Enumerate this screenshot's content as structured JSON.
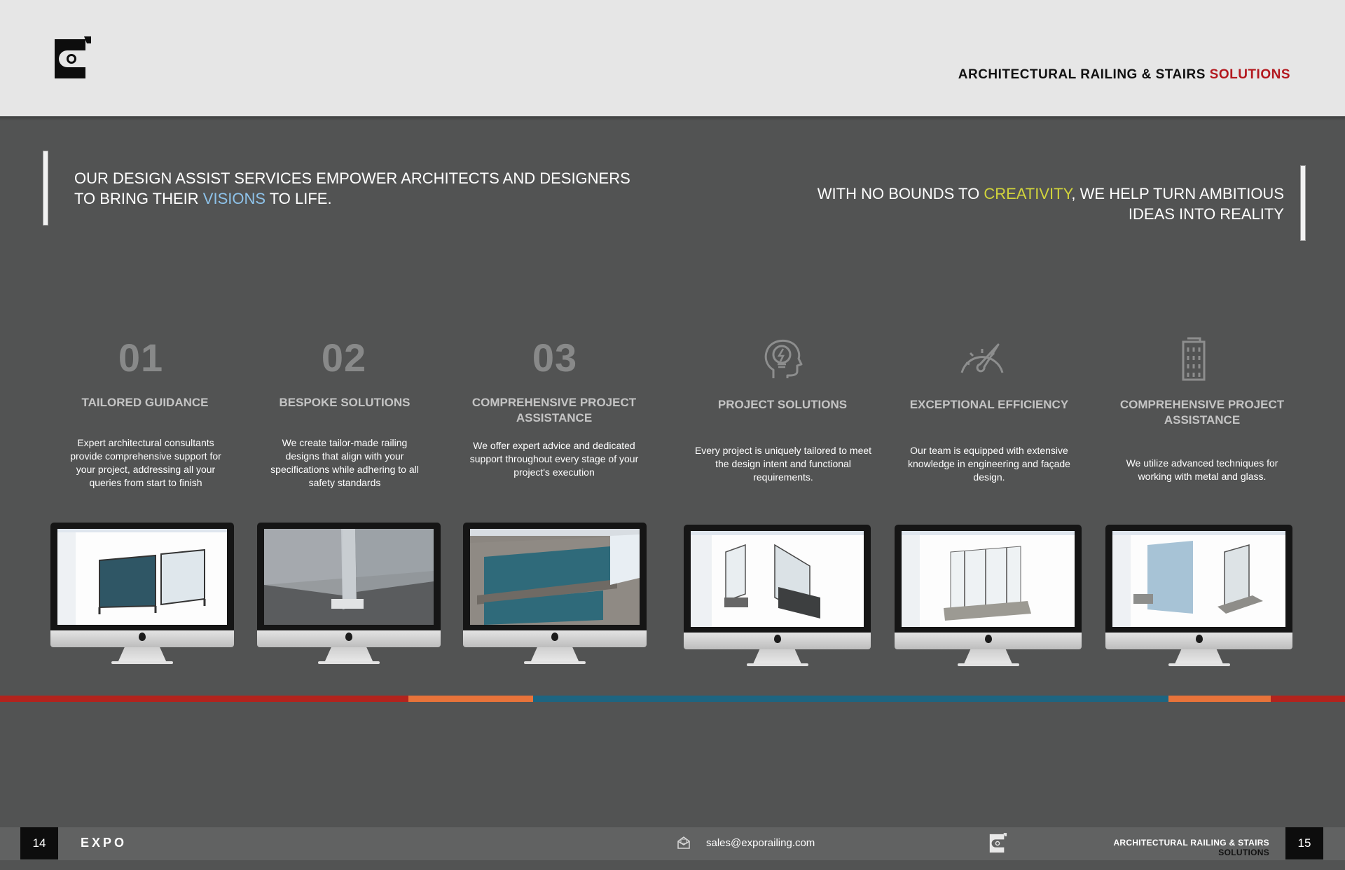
{
  "header": {
    "title_main": "ARCHITECTURAL RAILING & STAIRS ",
    "title_accent": "SOLUTIONS"
  },
  "quote_left": {
    "before": "OUR DESIGN ASSIST SERVICES EMPOWER ARCHITECTS AND DESIGNERS TO BRING THEIR ",
    "highlight": "VISIONS",
    "after": " TO LIFE."
  },
  "quote_right": {
    "before": "WITH NO BOUNDS TO ",
    "highlight": "CREATIVITY",
    "after": ", WE HELP TURN AMBITIOUS IDEAS INTO REALITY"
  },
  "features_left": [
    {
      "num": "01",
      "title": "TAILORED GUIDANCE",
      "desc": "Expert architectural consultants provide comprehensive support for your project, addressing all your queries from start to finish"
    },
    {
      "num": "02",
      "title": "BESPOKE SOLUTIONS",
      "desc": "We create tailor-made railing designs that align with your specifications while adhering to all safety standards"
    },
    {
      "num": "03",
      "title": "COMPREHENSIVE PROJECT ASSISTANCE",
      "desc": "We offer expert advice and dedicated support throughout every stage of your project's execution"
    }
  ],
  "features_right": [
    {
      "icon": "lightbulb-head-icon",
      "title": "PROJECT SOLUTIONS",
      "desc": "Every project is uniquely tailored to meet the design intent and functional requirements."
    },
    {
      "icon": "speedometer-icon",
      "title": "EXCEPTIONAL EFFICIENCY",
      "desc": "Our team is equipped with extensive knowledge in engineering and façade design."
    },
    {
      "icon": "building-icon",
      "title": "COMPREHENSIVE PROJECT ASSISTANCE",
      "desc": "We utilize advanced techniques for working with metal and glass."
    }
  ],
  "footer": {
    "page_left": "14",
    "brand": "EXPO",
    "email": "sales@exporailing.com",
    "tag_line1": "ARCHITECTURAL RAILING & STAIRS",
    "tag_line2": "SOLUTIONS",
    "page_right": "15"
  },
  "colors": {
    "stripe_red": "#b3231d",
    "stripe_orange": "#e8733a",
    "stripe_blue": "#1d6581",
    "accent_red": "#b3181e",
    "highlight_blue": "#8ec3ea",
    "highlight_yellow": "#d1d43b"
  }
}
